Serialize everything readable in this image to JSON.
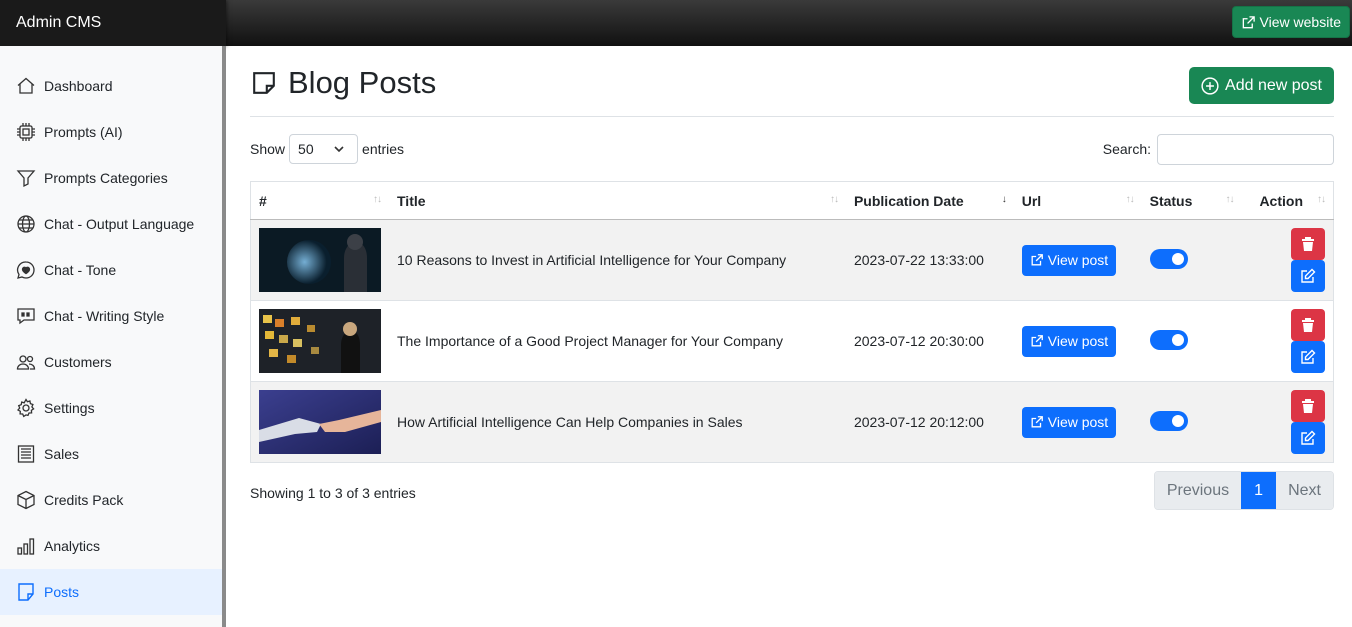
{
  "app": {
    "brand": "Admin CMS",
    "view_website": "View website"
  },
  "sidebar": {
    "items": [
      {
        "label": "Dashboard",
        "icon": "house-icon"
      },
      {
        "label": "Prompts (AI)",
        "icon": "cpu-icon"
      },
      {
        "label": "Prompts Categories",
        "icon": "funnel-icon"
      },
      {
        "label": "Chat - Output Language",
        "icon": "globe-icon"
      },
      {
        "label": "Chat - Tone",
        "icon": "chat-heart-icon"
      },
      {
        "label": "Chat - Writing Style",
        "icon": "chat-quote-icon"
      },
      {
        "label": "Customers",
        "icon": "people-icon"
      },
      {
        "label": "Settings",
        "icon": "gear-icon"
      },
      {
        "label": "Sales",
        "icon": "receipt-icon"
      },
      {
        "label": "Credits Pack",
        "icon": "box-icon"
      },
      {
        "label": "Analytics",
        "icon": "bar-chart-icon"
      },
      {
        "label": "Posts",
        "icon": "sticky-note-icon",
        "active": true
      }
    ]
  },
  "main": {
    "title": "Blog Posts",
    "add_button": "Add new post",
    "controls": {
      "show": "Show",
      "entries_value": "50",
      "entries": "entries",
      "search_label": "Search:",
      "search_value": ""
    },
    "table": {
      "columns": [
        "#",
        "Title",
        "Publication Date",
        "Url",
        "Status",
        "Action"
      ],
      "rows": [
        {
          "title": "10 Reasons to Invest in Artificial Intelligence for Your Company",
          "date": "2023-07-22 13:33:00",
          "url_label": "View post",
          "status": true,
          "thumb": "ai-hologram"
        },
        {
          "title": "The Importance of a Good Project Manager for Your Company",
          "date": "2023-07-12 20:30:00",
          "url_label": "View post",
          "status": true,
          "thumb": "sticky-notes-wall"
        },
        {
          "title": "How Artificial Intelligence Can Help Companies in Sales",
          "date": "2023-07-12 20:12:00",
          "url_label": "View post",
          "status": true,
          "thumb": "robot-handshake"
        }
      ]
    },
    "footer": {
      "info": "Showing 1 to 3 of 3 entries",
      "previous": "Previous",
      "current_page": "1",
      "next": "Next"
    }
  },
  "colors": {
    "primary": "#0d6efd",
    "success": "#198754",
    "danger": "#dc3545"
  }
}
